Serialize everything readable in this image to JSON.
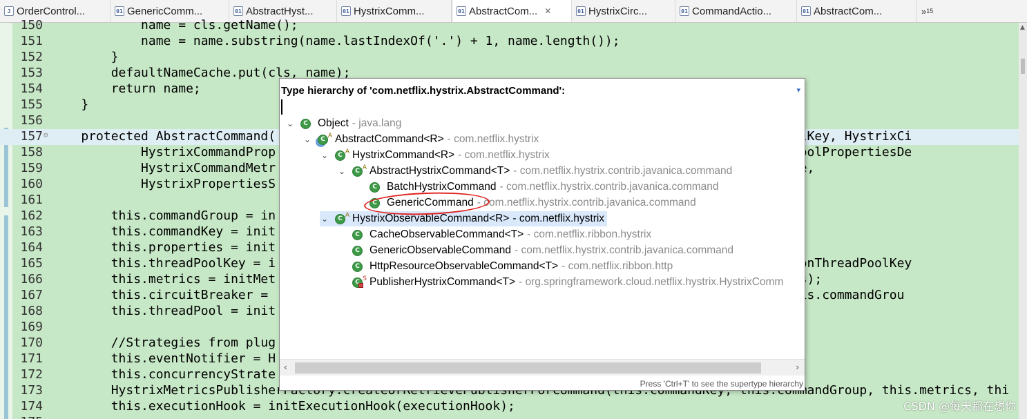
{
  "tabs": [
    {
      "label": "OrderControl...",
      "icon": "java-file-icon",
      "active": false
    },
    {
      "label": "GenericComm...",
      "icon": "class-file-icon",
      "active": false
    },
    {
      "label": "AbstractHyst...",
      "icon": "class-file-icon",
      "active": false
    },
    {
      "label": "HystrixComm...",
      "icon": "class-file-icon",
      "active": false
    },
    {
      "label": "AbstractCom...",
      "icon": "class-file-icon",
      "active": true,
      "close": "✕"
    },
    {
      "label": "HystrixCirc...",
      "icon": "class-file-icon",
      "active": false
    },
    {
      "label": "CommandActio...",
      "icon": "class-file-icon",
      "active": false
    },
    {
      "label": "AbstractCom...",
      "icon": "class-file-icon",
      "active": false
    }
  ],
  "tab_overflow": {
    "symbol": "»",
    "count": "15"
  },
  "code_lines": [
    {
      "ln": "150",
      "text": "            name = cls.getName();"
    },
    {
      "ln": "151",
      "text": "            name = name.substring(name.lastIndexOf('.') + 1, name.length());"
    },
    {
      "ln": "152",
      "text": "        }"
    },
    {
      "ln": "153",
      "text": "        defaultNameCache.put(cls, name);"
    },
    {
      "ln": "154",
      "text": "        return name;"
    },
    {
      "ln": "155",
      "text": "    }"
    },
    {
      "ln": "156",
      "text": ""
    },
    {
      "ln": "157",
      "text": "    protected AbstractCommand(                                                        lKey threadPoolKey, HystrixCi",
      "current": true,
      "fold": "⊖"
    },
    {
      "ln": "158",
      "text": "            HystrixCommandProp                                                        Setter threadPoolPropertiesDe"
    },
    {
      "ln": "159",
      "text": "            HystrixCommandMetr                                                        cutionSemaphore,"
    },
    {
      "ln": "160",
      "text": "            HystrixPropertiesS                                                        ) {"
    },
    {
      "ln": "161",
      "text": ""
    },
    {
      "ln": "162",
      "text": "        this.commandGroup = in"
    },
    {
      "ln": "163",
      "text": "        this.commandKey = init"
    },
    {
      "ln": "164",
      "text": "        this.properties = init                                                        iesDefaults);"
    },
    {
      "ln": "165",
      "text": "        this.threadPoolKey = i                                                        ecutionIsolationThreadPoolKey"
    },
    {
      "ln": "166",
      "text": "        this.metrics = initMet                                                        this.properties);"
    },
    {
      "ln": "167",
      "text": "        this.circuitBreaker =                                                         uitBreaker, this.commandGrou"
    },
    {
      "ln": "168",
      "text": "        this.threadPool = init                                                        ts);"
    },
    {
      "ln": "169",
      "text": ""
    },
    {
      "ln": "170",
      "text": "        //Strategies from plug"
    },
    {
      "ln": "171",
      "text": "        this.eventNotifier = H"
    },
    {
      "ln": "172",
      "text": "        this.concurrencyStrate"
    },
    {
      "ln": "173",
      "text": "        HystrixMetricsPublisherFactory.createOrRetrievePublisherForCommand(this.commandKey, this.commandGroup, this.metrics, thi"
    },
    {
      "ln": "174",
      "text": "        this.executionHook = initExecutionHook(executionHook);"
    },
    {
      "ln": "175",
      "text": ""
    }
  ],
  "popup": {
    "title": "Type hierarchy of 'com.netflix.hystrix.AbstractCommand':",
    "menu_icon": "▾",
    "filter_value": "",
    "status": "Press 'Ctrl+T' to see the supertype hierarchy",
    "scroll_left": "‹",
    "scroll_right": "›",
    "tree": [
      {
        "name": "Object",
        "pkg": "- java.lang",
        "depth": 0,
        "twisty": "⌄",
        "sup": "",
        "kind": "class"
      },
      {
        "name": "AbstractCommand<R>",
        "pkg": "- com.netflix.hystrix",
        "depth": 1,
        "twisty": "⌄",
        "sup": "A",
        "kind": "focus"
      },
      {
        "name": "HystrixCommand<R>",
        "pkg": "- com.netflix.hystrix",
        "depth": 2,
        "twisty": "⌄",
        "sup": "A",
        "kind": "class"
      },
      {
        "name": "AbstractHystrixCommand<T>",
        "pkg": "- com.netflix.hystrix.contrib.javanica.command",
        "depth": 3,
        "twisty": "⌄",
        "sup": "A",
        "kind": "class"
      },
      {
        "name": "BatchHystrixCommand",
        "pkg": "- com.netflix.hystrix.contrib.javanica.command",
        "depth": 4,
        "twisty": "",
        "sup": "",
        "kind": "class"
      },
      {
        "name": "GenericCommand",
        "pkg": "- com.netflix.hystrix.contrib.javanica.command",
        "depth": 4,
        "twisty": "",
        "sup": "",
        "kind": "class"
      },
      {
        "name": "HystrixObservableCommand<R>",
        "pkg": "- com.netflix.hystrix",
        "depth": 2,
        "twisty": "⌄",
        "sup": "A",
        "kind": "class",
        "selected": true
      },
      {
        "name": "CacheObservableCommand<T>",
        "pkg": "- com.netflix.ribbon.hystrix",
        "depth": 3,
        "twisty": "",
        "sup": "",
        "kind": "class"
      },
      {
        "name": "GenericObservableCommand",
        "pkg": "- com.netflix.hystrix.contrib.javanica.command",
        "depth": 3,
        "twisty": "",
        "sup": "",
        "kind": "class"
      },
      {
        "name": "HttpResourceObservableCommand<T>",
        "pkg": "- com.netflix.ribbon.http",
        "depth": 3,
        "twisty": "",
        "sup": "",
        "kind": "class"
      },
      {
        "name": "PublisherHystrixCommand<T>",
        "pkg": "- org.springframework.cloud.netflix.hystrix.HystrixComm",
        "depth": 3,
        "twisty": "",
        "sup": "S",
        "kind": "private"
      }
    ]
  },
  "watermark": "CSDN @每天都在想你"
}
